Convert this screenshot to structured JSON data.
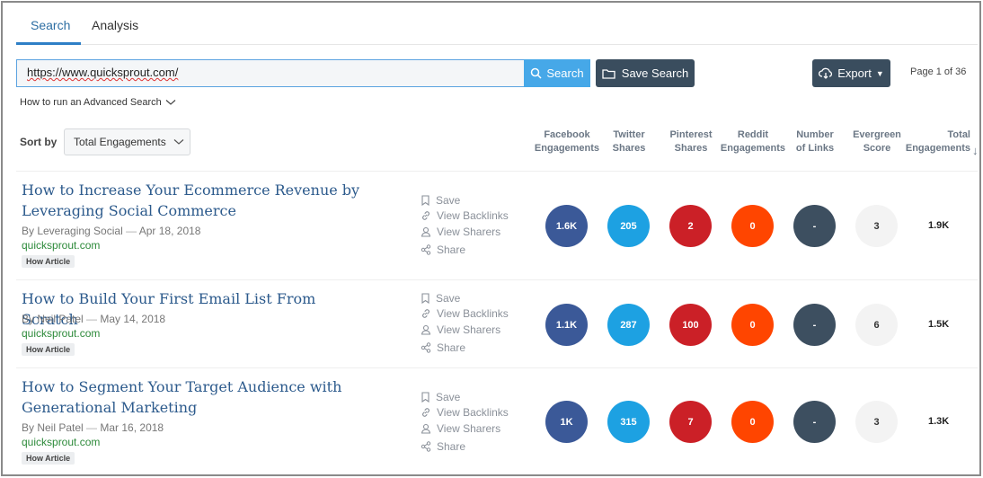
{
  "tabs": [
    {
      "label": "Search"
    },
    {
      "label": "Analysis"
    }
  ],
  "search": {
    "value": "https://www.quicksprout.com/",
    "button_label": "Search"
  },
  "save_search_label": "Save Search",
  "export_label": "Export",
  "pagination": {
    "text": "Page 1 of 36"
  },
  "advanced_search_label": "How to run an Advanced Search",
  "sort": {
    "label": "Sort by",
    "selected": "Total Engagements"
  },
  "columns": [
    {
      "line1": "Facebook",
      "line2": "Engagements"
    },
    {
      "line1": "Twitter",
      "line2": "Shares"
    },
    {
      "line1": "Pinterest",
      "line2": "Shares"
    },
    {
      "line1": "Reddit",
      "line2": "Engagements"
    },
    {
      "line1": "Number",
      "line2": "of Links"
    },
    {
      "line1": "Evergreen",
      "line2": "Score"
    },
    {
      "line1": "Total",
      "line2": "Engagements"
    }
  ],
  "actions": {
    "save": "Save",
    "backlinks": "View Backlinks",
    "sharers": "View Sharers",
    "share": "Share"
  },
  "colors": {
    "facebook": "#3b5998",
    "twitter": "#1da1e2",
    "pinterest": "#cb2027",
    "reddit": "#ff4500",
    "links": "#3d4f60",
    "evergreen": "#f3f3f3"
  },
  "results": [
    {
      "title": "How to Increase Your Ecommerce Revenue by Leveraging Social Commerce",
      "author": "By Leveraging Social",
      "date": "Apr 18, 2018",
      "domain": "quicksprout.com",
      "badge": "How Article",
      "facebook": "1.6K",
      "twitter": "205",
      "pinterest": "2",
      "reddit": "0",
      "links": "-",
      "evergreen": "3",
      "total": "1.9K"
    },
    {
      "title": "How to Build Your First Email List From Scratch",
      "author": "By Neil Patel",
      "date": "May 14, 2018",
      "domain": "quicksprout.com",
      "badge": "How Article",
      "facebook": "1.1K",
      "twitter": "287",
      "pinterest": "100",
      "reddit": "0",
      "links": "-",
      "evergreen": "6",
      "total": "1.5K"
    },
    {
      "title": "How to Segment Your Target Audience with Generational Marketing",
      "author": "By Neil Patel",
      "date": "Mar 16, 2018",
      "domain": "quicksprout.com",
      "badge": "How Article",
      "facebook": "1K",
      "twitter": "315",
      "pinterest": "7",
      "reddit": "0",
      "links": "-",
      "evergreen": "3",
      "total": "1.3K"
    }
  ]
}
